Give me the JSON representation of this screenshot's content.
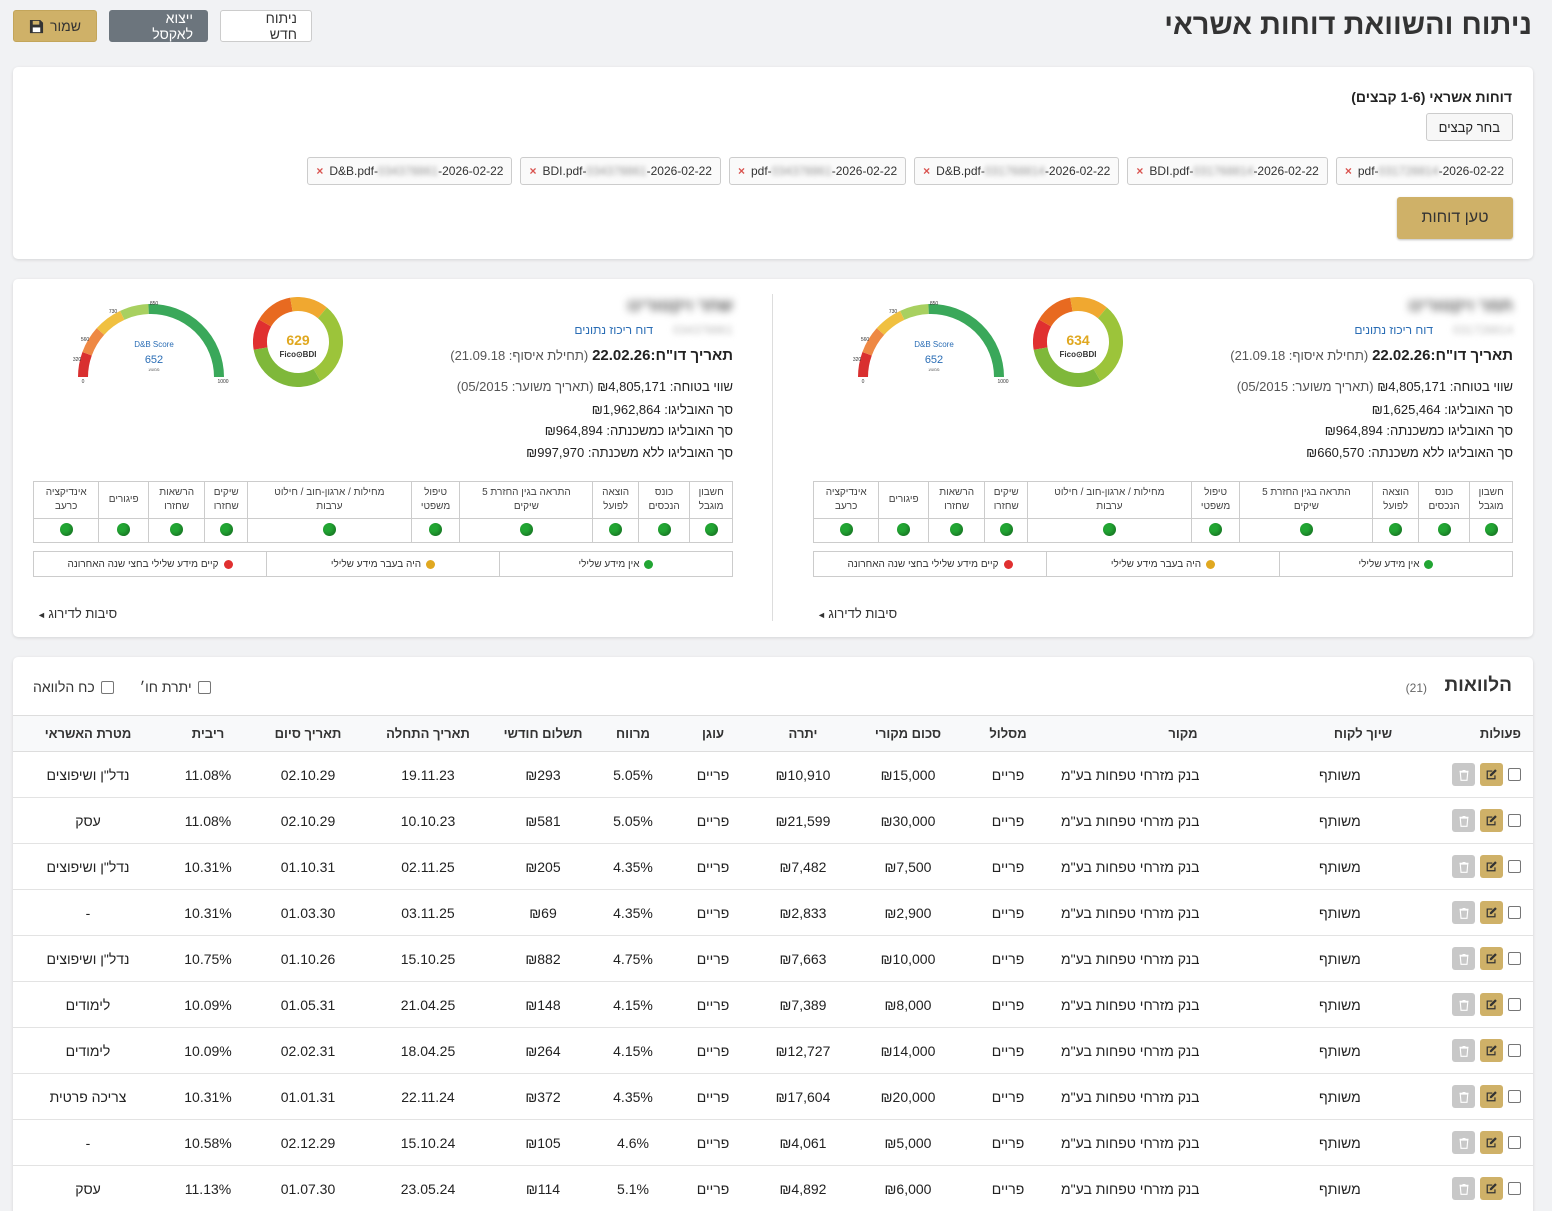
{
  "header": {
    "title": "ניתוח והשוואת דוחות אשראי",
    "new_label": "ניתוח חדש",
    "excel_label": "ייצוא לאקסל",
    "save_label": "שמור"
  },
  "upload": {
    "title": "דוחות אשראי (1-6 קבצים)",
    "choose_label": "בחר קבצים",
    "load_label": "טען דוחות",
    "files": [
      {
        "name": "pdf-",
        "suffix": "-2026-02-22",
        "blur": "031728814"
      },
      {
        "name": "BDI.pdf-",
        "suffix": "-2026-02-22",
        "blur": "031768814"
      },
      {
        "name": "D&B.pdf-",
        "suffix": "-2026-02-22",
        "blur": "031768814"
      },
      {
        "name": "pdf-",
        "suffix": "-2026-02-22",
        "blur": "034378861"
      },
      {
        "name": "BDI.pdf-",
        "suffix": "-2026-02-22",
        "blur": "034378861"
      },
      {
        "name": "D&B.pdf-",
        "suffix": "-2026-02-22",
        "blur": "034378861"
      }
    ]
  },
  "reports": [
    {
      "name": "תמר ויקטורינו",
      "id": "031728814",
      "summary_link": "דוח ריכוז נתונים",
      "date_label": "תאריך דו\"ח:",
      "date": "22.02.26",
      "collect": "(תחילת איסוף: 21.09.18)",
      "insurance_label": "שווי בטוחה:",
      "insurance": "₪4,805,171",
      "appraisal": "(תאריך משוער: 05/2015)",
      "obligo_label": "סך האובליגו:",
      "obligo": "₪1,625,464",
      "mortgage_label": "סך האובליגו כמשכנתה:",
      "mortgage": "₪964,894",
      "nomortgage_label": "סך האובליגו ללא משכנתה:",
      "nomortgage": "₪660,570",
      "fico": "634",
      "fico_label": "Fico⊙BDI",
      "db_label": "D&B Score",
      "db": "652",
      "db_sub": "ממוצע"
    },
    {
      "name": "שחר ויקטורינו",
      "id": "034378861",
      "summary_link": "דוח ריכוז נתונים",
      "date_label": "תאריך דו\"ח:",
      "date": "22.02.26",
      "collect": "(תחילת איסוף: 21.09.18)",
      "insurance_label": "שווי בטוחה:",
      "insurance": "₪4,805,171",
      "appraisal": "(תאריך משוער: 05/2015)",
      "obligo_label": "סך האובליגו:",
      "obligo": "₪1,962,864",
      "mortgage_label": "סך האובליגו כמשכנתה:",
      "mortgage": "₪964,894",
      "nomortgage_label": "סך האובליגו ללא משכנתה:",
      "nomortgage": "₪997,970",
      "fico": "629",
      "fico_label": "Fico⊙BDI",
      "db_label": "D&B Score",
      "db": "652",
      "db_sub": "ממוצע"
    }
  ],
  "gauge_ticks": [
    "0",
    "320",
    "560",
    "730",
    "850",
    "1000"
  ],
  "indicators": [
    {
      "l1": "חשבון",
      "l2": "מוגבל"
    },
    {
      "l1": "כונס",
      "l2": "הנכסים"
    },
    {
      "l1": "הוצאה",
      "l2": "לפועל"
    },
    {
      "l1": "התראה בגין החזרת 5",
      "l2": "שיקים"
    },
    {
      "l1": "טיפול",
      "l2": "משפטי"
    },
    {
      "l1": "מחילות / ארגון-חוב / חילוט",
      "l2": "ערבות"
    },
    {
      "l1": "שיקים",
      "l2": "שחזרו"
    },
    {
      "l1": "הרשאות",
      "l2": "שחזרו"
    },
    {
      "l1": "פיגורים",
      "l2": ""
    },
    {
      "l1": "אינדיקציה",
      "l2": "כרעב"
    }
  ],
  "legend": {
    "green": "אין מידע שלילי",
    "yellow": "היה בעבר מידע שלילי",
    "red": "קיים מידע שלילי בחצי שנה האחרונה"
  },
  "reasons_label": "סיבות לדירוג",
  "colors": {
    "gold": "#cfb168",
    "green": "#22a533",
    "yellow": "#e0a820",
    "red": "#e03030"
  },
  "loans": {
    "title": "הלוואות",
    "count": "(21)",
    "filter1": "יתרת חו׳",
    "filter2": "כח הלוואה",
    "columns": [
      "פעולות",
      "שיוך לקוח",
      "מקור",
      "מסלול",
      "סכום מקורי",
      "יתרה",
      "עוגן",
      "מרווח",
      "תשלום חודשי",
      "תאריך התחלה",
      "תאריך סיום",
      "ריבית",
      "מטרת האשראי"
    ],
    "rows": [
      [
        "משותף",
        "בנק מזרחי טפחות בע\"מ",
        "פריים",
        "₪15,000",
        "₪10,910",
        "פריים",
        "5.05%",
        "₪293",
        "19.11.23",
        "02.10.29",
        "11.08%",
        "נדל\"ן ושיפוצים"
      ],
      [
        "משותף",
        "בנק מזרחי טפחות בע\"מ",
        "פריים",
        "₪30,000",
        "₪21,599",
        "פריים",
        "5.05%",
        "₪581",
        "10.10.23",
        "02.10.29",
        "11.08%",
        "עסק"
      ],
      [
        "משותף",
        "בנק מזרחי טפחות בע\"מ",
        "פריים",
        "₪7,500",
        "₪7,482",
        "פריים",
        "4.35%",
        "₪205",
        "02.11.25",
        "01.10.31",
        "10.31%",
        "נדל\"ן ושיפוצים"
      ],
      [
        "משותף",
        "בנק מזרחי טפחות בע\"מ",
        "פריים",
        "₪2,900",
        "₪2,833",
        "פריים",
        "4.35%",
        "₪69",
        "03.11.25",
        "01.03.30",
        "10.31%",
        "-"
      ],
      [
        "משותף",
        "בנק מזרחי טפחות בע\"מ",
        "פריים",
        "₪10,000",
        "₪7,663",
        "פריים",
        "4.75%",
        "₪882",
        "15.10.25",
        "01.10.26",
        "10.75%",
        "נדל\"ן ושיפוצים"
      ],
      [
        "משותף",
        "בנק מזרחי טפחות בע\"מ",
        "פריים",
        "₪8,000",
        "₪7,389",
        "פריים",
        "4.15%",
        "₪148",
        "21.04.25",
        "01.05.31",
        "10.09%",
        "לימודים"
      ],
      [
        "משותף",
        "בנק מזרחי טפחות בע\"מ",
        "פריים",
        "₪14,000",
        "₪12,727",
        "פריים",
        "4.15%",
        "₪264",
        "18.04.25",
        "02.02.31",
        "10.09%",
        "לימודים"
      ],
      [
        "משותף",
        "בנק מזרחי טפחות בע\"מ",
        "פריים",
        "₪20,000",
        "₪17,604",
        "פריים",
        "4.35%",
        "₪372",
        "22.11.24",
        "01.01.31",
        "10.31%",
        "צריכה פרטית"
      ],
      [
        "משותף",
        "בנק מזרחי טפחות בע\"מ",
        "פריים",
        "₪5,000",
        "₪4,061",
        "פריים",
        "4.6%",
        "₪105",
        "15.10.24",
        "02.12.29",
        "10.58%",
        "-"
      ],
      [
        "משותף",
        "בנק מזרחי טפחות בע\"מ",
        "פריים",
        "₪6,000",
        "₪4,892",
        "פריים",
        "5.1%",
        "₪114",
        "23.05.24",
        "01.07.30",
        "11.13%",
        "עסק"
      ]
    ]
  }
}
